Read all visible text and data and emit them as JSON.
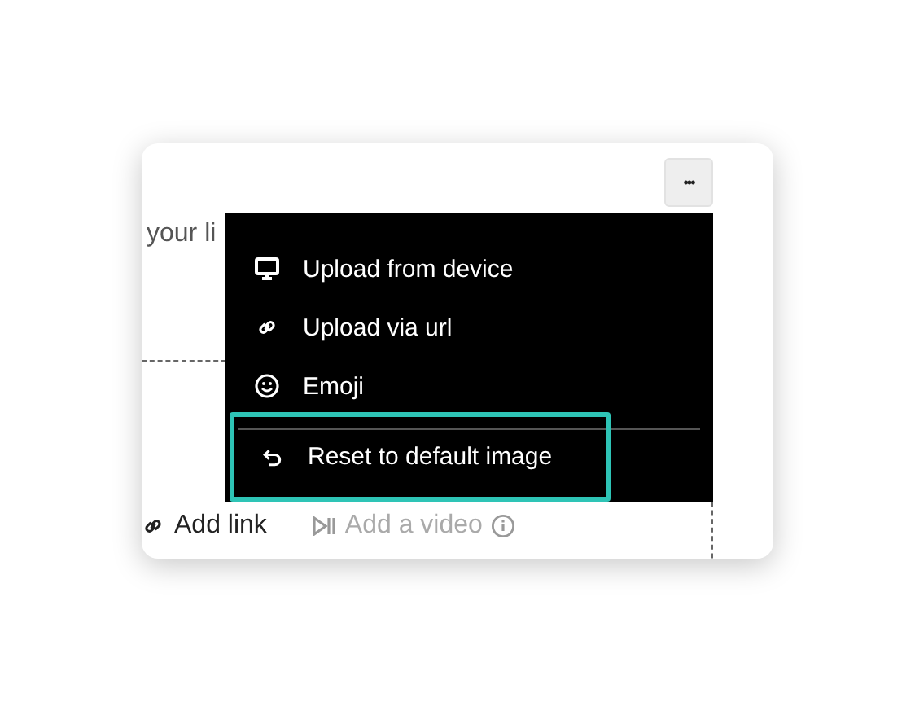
{
  "card": {
    "partial_text": "your li",
    "links": [
      {
        "label": "Add link",
        "disabled": false
      },
      {
        "label": "Add a video",
        "disabled": true
      }
    ]
  },
  "more_button": {
    "label": "•••"
  },
  "menu": {
    "items": [
      {
        "kind": "device",
        "label": "Upload from device",
        "focused": false
      },
      {
        "kind": "url",
        "label": "Upload via url",
        "focused": false
      },
      {
        "kind": "emoji",
        "label": "Emoji",
        "focused": false
      },
      {
        "kind": "reset",
        "label": "Reset to default image",
        "focused": true
      }
    ]
  }
}
